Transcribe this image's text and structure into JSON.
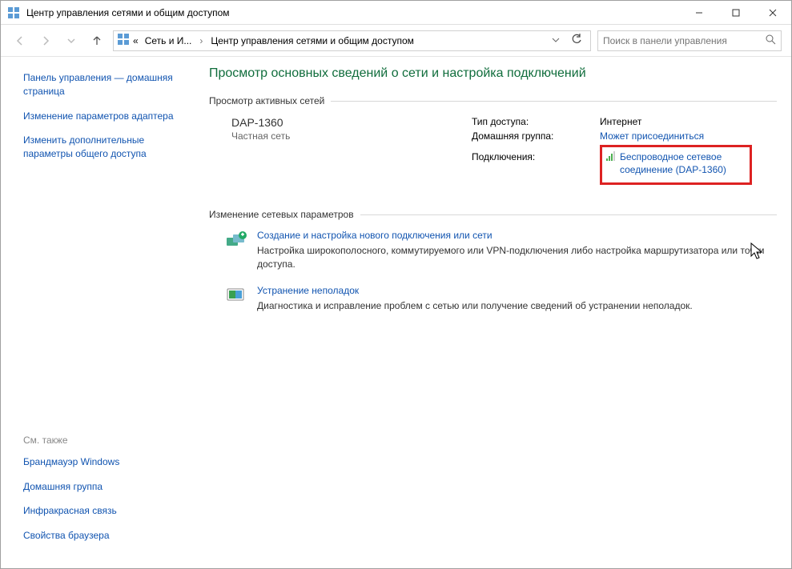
{
  "window": {
    "title": "Центр управления сетями и общим доступом"
  },
  "nav": {
    "breadcrumb1": "Сеть и И...",
    "breadcrumb2": "Центр управления сетями и общим доступом",
    "search_placeholder": "Поиск в панели управления"
  },
  "sidebar": {
    "home": "Панель управления — домашняя страница",
    "adapter": "Изменение параметров адаптера",
    "sharing": "Изменить дополнительные параметры общего доступа",
    "see_also": "См. также",
    "firewall": "Брандмауэр Windows",
    "homegroup": "Домашняя группа",
    "infrared": "Инфракрасная связь",
    "browser": "Свойства браузера"
  },
  "main": {
    "page_title": "Просмотр основных сведений о сети и настройка подключений",
    "active_header": "Просмотр активных сетей",
    "net_name": "DAP-1360",
    "net_type": "Частная сеть",
    "access_lbl": "Тип доступа:",
    "access_val": "Интернет",
    "homegrp_lbl": "Домашняя группа:",
    "homegrp_val": "Может присоединиться",
    "conn_lbl": "Подключения:",
    "conn_val": "Беспроводное сетевое соединение (DAP-1360)",
    "change_header": "Изменение сетевых параметров",
    "opt1_link": "Создание и настройка нового подключения или сети",
    "opt1_desc": "Настройка широкополосного, коммутируемого или VPN-подключения либо настройка маршрутизатора или точки доступа.",
    "opt2_link": "Устранение неполадок",
    "opt2_desc": "Диагностика и исправление проблем с сетью или получение сведений об устранении неполадок."
  }
}
